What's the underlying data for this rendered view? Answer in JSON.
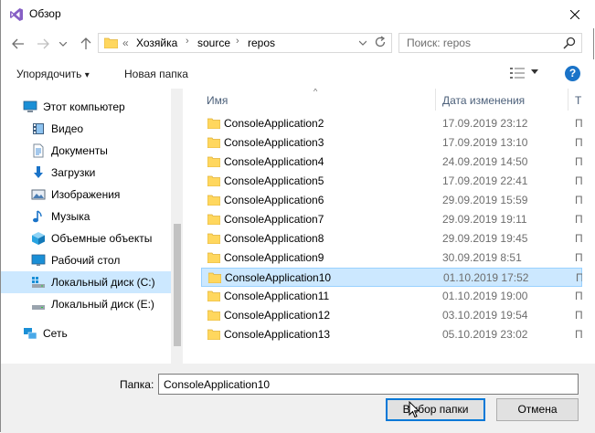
{
  "window": {
    "title": "Обзор"
  },
  "address": {
    "overflow": "«",
    "crumbs": [
      "Хозяйка",
      "source",
      "repos"
    ],
    "separator": "›"
  },
  "search": {
    "placeholder": "Поиск: repos"
  },
  "toolbar": {
    "organize_label": "Упорядочить",
    "organize_arrow": "▾",
    "new_folder_label": "Новая папка",
    "help_label": "?"
  },
  "sidebar": {
    "items": [
      {
        "label": "Этот компьютер",
        "icon": "computer-icon"
      },
      {
        "label": "Видео",
        "icon": "video-icon"
      },
      {
        "label": "Документы",
        "icon": "documents-icon"
      },
      {
        "label": "Загрузки",
        "icon": "downloads-icon"
      },
      {
        "label": "Изображения",
        "icon": "pictures-icon"
      },
      {
        "label": "Музыка",
        "icon": "music-icon"
      },
      {
        "label": "Объемные объекты",
        "icon": "3d-objects-icon"
      },
      {
        "label": "Рабочий стол",
        "icon": "desktop-icon"
      },
      {
        "label": "Локальный диск (C:)",
        "icon": "drive-c-icon",
        "selected": true
      },
      {
        "label": "Локальный диск (E:)",
        "icon": "drive-e-icon"
      },
      {
        "label": "Сеть",
        "icon": "network-icon"
      }
    ]
  },
  "filelist": {
    "columns": {
      "name": "Имя",
      "date": "Дата изменения",
      "type": "Т"
    },
    "type_glyph": "П",
    "rows": [
      {
        "name": "ConsoleApplication2",
        "date": "17.09.2019 23:12"
      },
      {
        "name": "ConsoleApplication3",
        "date": "17.09.2019 13:10"
      },
      {
        "name": "ConsoleApplication4",
        "date": "24.09.2019 14:50"
      },
      {
        "name": "ConsoleApplication5",
        "date": "17.09.2019 22:41"
      },
      {
        "name": "ConsoleApplication6",
        "date": "29.09.2019 15:59"
      },
      {
        "name": "ConsoleApplication7",
        "date": "29.09.2019 19:11"
      },
      {
        "name": "ConsoleApplication8",
        "date": "29.09.2019 19:45"
      },
      {
        "name": "ConsoleApplication9",
        "date": "30.09.2019 8:51"
      },
      {
        "name": "ConsoleApplication10",
        "date": "01.10.2019 17:52",
        "selected": true
      },
      {
        "name": "ConsoleApplication11",
        "date": "01.10.2019 19:00"
      },
      {
        "name": "ConsoleApplication12",
        "date": "03.10.2019 19:54"
      },
      {
        "name": "ConsoleApplication13",
        "date": "05.10.2019 23:02"
      }
    ]
  },
  "footer": {
    "folder_label": "Папка:",
    "folder_value": "ConsoleApplication10",
    "select_button": "Выбор папки",
    "cancel_button": "Отмена"
  },
  "colors": {
    "accent": "#0078d7",
    "selection": "#cce8ff",
    "folder": "#ffd75e",
    "vs_purple": "#865fc5"
  }
}
